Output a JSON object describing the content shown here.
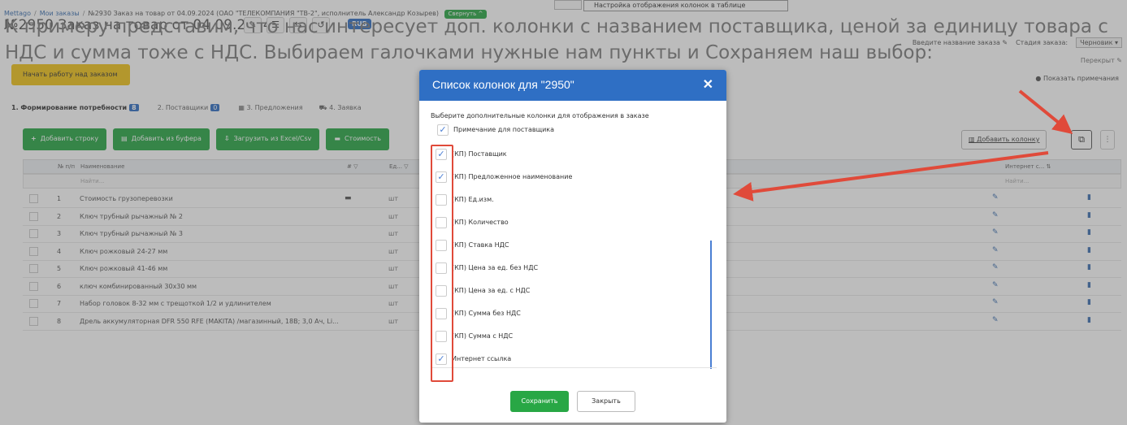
{
  "background": {
    "breadcrumb": [
      "Mettago",
      "Мои заказы",
      "№2930 Заказ на товар от 04.09.2024 (ОАО \"ТЕЛЕКОМПАНИЯ \"ТВ-2\", исполнитель Александр Козырев)"
    ],
    "collapse_label": "Свернуть ^",
    "tooltip": "Настройка отображения колонок в таблице",
    "order_title": "№2950 Заказ на товар от 04.09.2024",
    "title_icons": [
      "✎",
      "☰",
      "⇆",
      "↺"
    ],
    "currency": "RUB",
    "right_meta": {
      "order_name_hint": "Введите название заказа ✎",
      "stage_label": "Стадия заказа:",
      "stage_value": "Черновик ▾",
      "secondary": "Перекрыт ✎",
      "show_notes": "Показать примечания"
    },
    "start_button": "Начать работу над заказом",
    "tabs": [
      {
        "label": "1. Формирование потребности",
        "count": "8",
        "active": true
      },
      {
        "label": "2. Поставщики",
        "count": "0",
        "active": false
      },
      {
        "label": "3. Предложения",
        "count": "",
        "active": false
      },
      {
        "label": "4. Заявка",
        "count": "",
        "active": false
      }
    ],
    "toolbar": [
      {
        "label": "Добавить строку",
        "icon": "+"
      },
      {
        "label": "Добавить из буфера",
        "icon": "▤"
      },
      {
        "label": "Загрузить из Excel/Csv",
        "icon": "⇩"
      },
      {
        "label": "Стоимость",
        "icon": "▬"
      }
    ],
    "add_column_label": "Добавить колонку",
    "columns": {
      "num": "№ п/п",
      "name": "Наименование",
      "qty": "# ▽",
      "unit": "Ед... ▽",
      "internet": "Интернет с... ⇅"
    },
    "filter_placeholder": "Найти...",
    "rows": [
      {
        "num": "1",
        "name": "Стоимость грузоперевозки",
        "unit": "шт",
        "truck": true
      },
      {
        "num": "2",
        "name": "Ключ трубный рычажный № 2",
        "unit": "шт",
        "truck": false
      },
      {
        "num": "3",
        "name": "Ключ трубный рычажный № 3",
        "unit": "шт",
        "truck": false
      },
      {
        "num": "4",
        "name": "Ключ рожковый 24-27 мм",
        "unit": "шт",
        "truck": false
      },
      {
        "num": "5",
        "name": "Ключ рожковый 41-46 мм",
        "unit": "шт",
        "truck": false
      },
      {
        "num": "6",
        "name": "ключ комбинированный 30х30 мм",
        "unit": "шт",
        "truck": false
      },
      {
        "num": "7",
        "name": "Набор головок 8-32 мм с трещоткой 1/2 и удлинителем",
        "unit": "шт",
        "truck": false
      },
      {
        "num": "8",
        "name": "Дрель аккумуляторная DFR 550 RFE (MAKITA) /магазинный, 18В; 3,0 Ач, Li...",
        "unit": "шт",
        "truck": false
      }
    ]
  },
  "modal": {
    "title": "Список колонок для \"2950\"",
    "prompt": "Выберите дополнительные колонки для отображения в заказе",
    "options": [
      {
        "label": "Примечание для поставщика",
        "checked": true
      },
      {
        "label": "(КП) Поставщик",
        "checked": true
      },
      {
        "label": "(КП) Предложенное наименование",
        "checked": true
      },
      {
        "label": "(КП) Ед.изм.",
        "checked": false
      },
      {
        "label": "(КП) Количество",
        "checked": false
      },
      {
        "label": "(КП) Ставка НДС",
        "checked": false
      },
      {
        "label": "(КП) Цена за ед. без НДС",
        "checked": false
      },
      {
        "label": "(КП) Цена за ед. с НДС",
        "checked": false
      },
      {
        "label": "(КП) Сумма без НДС",
        "checked": false
      },
      {
        "label": "(КП) Сумма с НДС",
        "checked": false
      },
      {
        "label": "Интернет ссылка",
        "checked": true
      }
    ],
    "save_label": "Сохранить",
    "close_label": "Закрыть"
  },
  "caption": "К примеру представим, что нас интересует доп. колонки с названием поставщика, ценой за единицу товара с НДС и сумма тоже с НДС. Выбираем галочками нужные нам пункты и Сохраняем наш выбор:",
  "colors": {
    "accent_blue": "#2f6fc4",
    "action_green": "#28a745",
    "annotation_red": "#e04a3a",
    "start_yellow": "#f0c419"
  }
}
